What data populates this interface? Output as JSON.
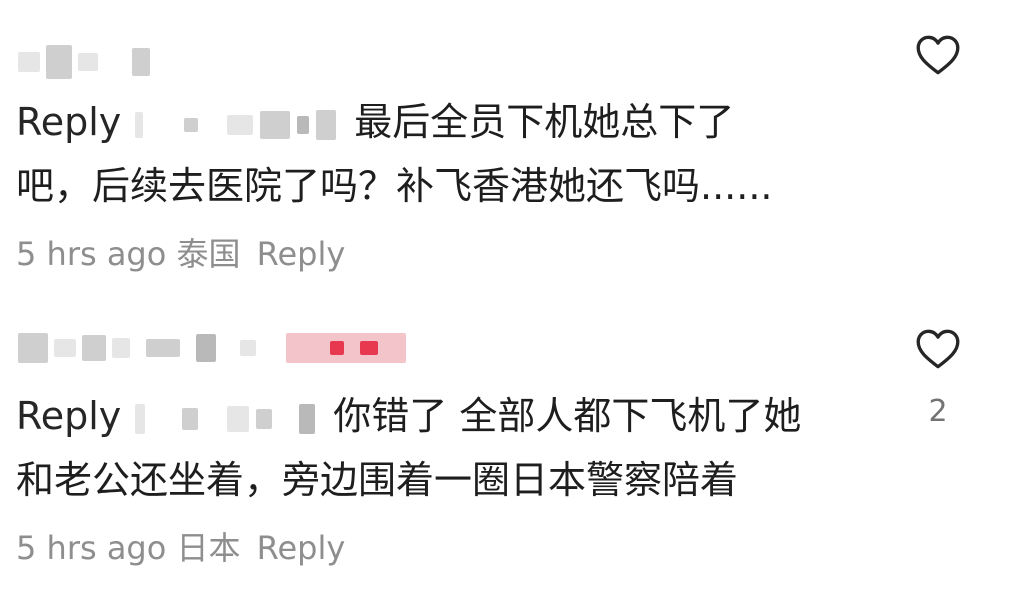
{
  "comments": [
    {
      "reply_prefix": "Reply",
      "text_line1": "最后全员下机她总下了",
      "text_line2": "吧，后续去医院了吗？补飞香港她还飞吗......",
      "time": "5 hrs ago",
      "location": "泰国",
      "reply_label": "Reply",
      "like_count": "",
      "icon": "heart-outline-icon"
    },
    {
      "reply_prefix": "Reply",
      "text_line1": "你错了 全部人都下飞机了她",
      "text_line2": "和老公还坐着，旁边围着一圈日本警察陪着",
      "time": "5 hrs ago",
      "location": "日本",
      "reply_label": "Reply",
      "like_count": "2",
      "icon": "heart-outline-icon"
    }
  ],
  "colors": {
    "text": "#1e1e1e",
    "meta": "#8e8e8e",
    "background": "#ffffff"
  }
}
